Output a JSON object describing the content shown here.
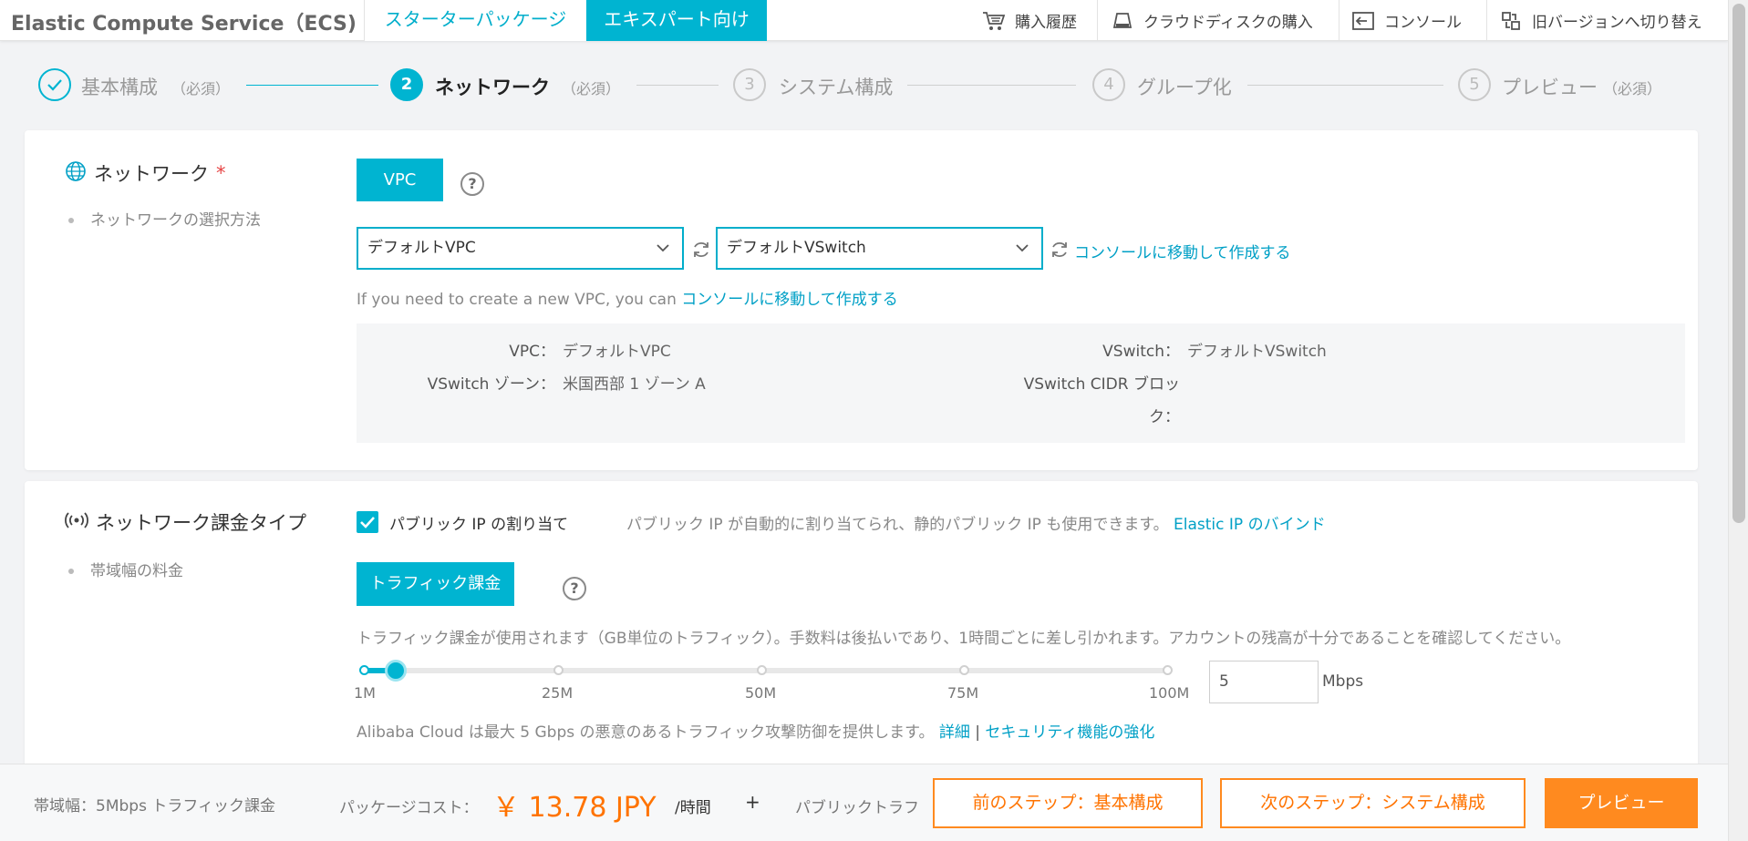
{
  "header": {
    "app_title": "Elastic Compute Service（ECS)",
    "tab_starter": "スターターパッケージ",
    "tab_expert": "エキスパート向け",
    "nav": [
      {
        "label": "購入履歴",
        "icon": "cart-icon"
      },
      {
        "label": "クラウドディスクの購入",
        "icon": "disk-icon"
      },
      {
        "label": "コンソール",
        "icon": "console-icon"
      },
      {
        "label": "旧バージョンへ切り替え",
        "icon": "switch-icon"
      }
    ]
  },
  "steps": [
    {
      "number": "✓",
      "label": "基本構成",
      "required": "（必須）",
      "state": "done"
    },
    {
      "number": "2",
      "label": "ネットワーク",
      "required": "（必須）",
      "state": "active"
    },
    {
      "number": "3",
      "label": "システム構成",
      "required": "",
      "state": "pending"
    },
    {
      "number": "4",
      "label": "グループ化",
      "required": "",
      "state": "pending"
    },
    {
      "number": "5",
      "label": "プレビュー",
      "required": "（必須）",
      "state": "pending"
    }
  ],
  "network": {
    "title": "ネットワーク",
    "required_mark": "*",
    "subtitle": "ネットワークの選択方法",
    "type_button": "VPC",
    "vpc_select": "デフォルトVPC",
    "vswitch_select": "デフォルトVSwitch",
    "create_link": "コンソールに移動して作成する",
    "hint_prefix": "If you need to create a new VPC, you can",
    "hint_link": "コンソールに移動して作成する",
    "info": {
      "vpc_label": "VPC：",
      "vpc_value": "デフォルトVPC",
      "vswitch_label": "VSwitch：",
      "vswitch_value": "デフォルトVSwitch",
      "zone_label": "VSwitch ゾーン：",
      "zone_value": "米国西部 1 ゾーン A",
      "cidr_label_line1": "VSwitch CIDR ブロッ",
      "cidr_label_line2": "ク："
    }
  },
  "billing": {
    "title": "ネットワーク課金タイプ",
    "subtitle": "帯域幅の料金",
    "public_ip_label": "パブリック IP の割り当て",
    "public_ip_checked": true,
    "public_ip_desc": "パブリック IP が自動的に割り当てられ、静的パブリック IP も使用できます。",
    "eip_link": "Elastic IP のバインド",
    "traffic_button": "トラフィック課金",
    "traffic_desc": "トラフィック課金が使用されます（GB単位のトラフィック）。手数料は後払いであり、1時間ごとに差し引かれます。アカウントの残高が十分であることを確認してください。",
    "slider_ticks": [
      "1M",
      "25M",
      "50M",
      "75M",
      "100M"
    ],
    "bandwidth_value": "5",
    "bandwidth_fraction": 0.04,
    "bandwidth_unit": "Mbps",
    "defense_text": "Alibaba Cloud は最大 5 Gbps の悪意のあるトラフィック攻撃防御を提供します。",
    "detail_link": "詳細",
    "separator": "|",
    "security_link": "セキュリティ機能の強化"
  },
  "footer": {
    "bandwidth_summary": "帯域幅：5Mbps トラフィック課金",
    "package_cost_label": "パッケージコスト：",
    "price": "￥ 13.78 JPY",
    "per_hour": "/時間",
    "plus": "+",
    "public_traffic": "パブリックトラフ",
    "prev_button": "前のステップ：基本構成",
    "next_button": "次のステップ：システム構成",
    "preview_button": "プレビュー"
  },
  "colors": {
    "accent": "#00b4d1",
    "link": "#00a0c6",
    "orange": "#ff7300",
    "required": "#e64545"
  }
}
